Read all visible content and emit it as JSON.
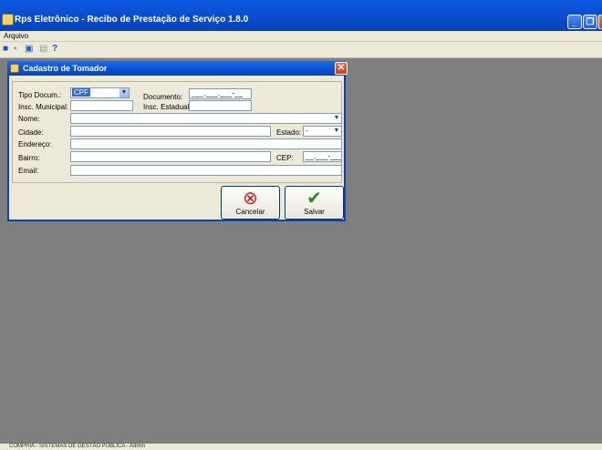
{
  "window": {
    "title": "Rps Eletrônico - Recibo de Prestação de Serviço 1.8.0"
  },
  "menubar": {
    "items": [
      "Arquivo"
    ]
  },
  "toolbar": {
    "icons": [
      "save-icon",
      "delete-icon",
      "screen-icon",
      "print-icon",
      "help-icon"
    ]
  },
  "dialog": {
    "title": "Cadastro de Tomador",
    "close_glyph": "✕",
    "fields": {
      "tipo_doc": {
        "label": "Tipo Docum.:",
        "value": "CPF"
      },
      "documento": {
        "label": "Documento:",
        "value": "___.___.___-__"
      },
      "insc_municipal": {
        "label": "Insc. Municipal:",
        "value": ""
      },
      "insc_estadual": {
        "label": "Insc. Estadual:",
        "value": ""
      },
      "nome": {
        "label": "Nome:",
        "value": ""
      },
      "cidade": {
        "label": "Cidade:",
        "value": ""
      },
      "estado": {
        "label": "Estado:",
        "value": "-"
      },
      "endereco": {
        "label": "Endereço:",
        "value": ""
      },
      "bairro": {
        "label": "Bairro:",
        "value": ""
      },
      "cep": {
        "label": "CEP:",
        "value": "__.___-___"
      },
      "email": {
        "label": "Email:",
        "value": ""
      }
    },
    "buttons": {
      "cancel": "Cancelar",
      "save": "Salvar"
    }
  },
  "status": {
    "text": "COMPRIA - SISTEMAS DE GESTÃO PÚBLICA - Admin"
  },
  "colors": {
    "title_blue": "#0b4fd4",
    "accent_red": "#d21c1c",
    "accent_green": "#2e8b1a"
  }
}
